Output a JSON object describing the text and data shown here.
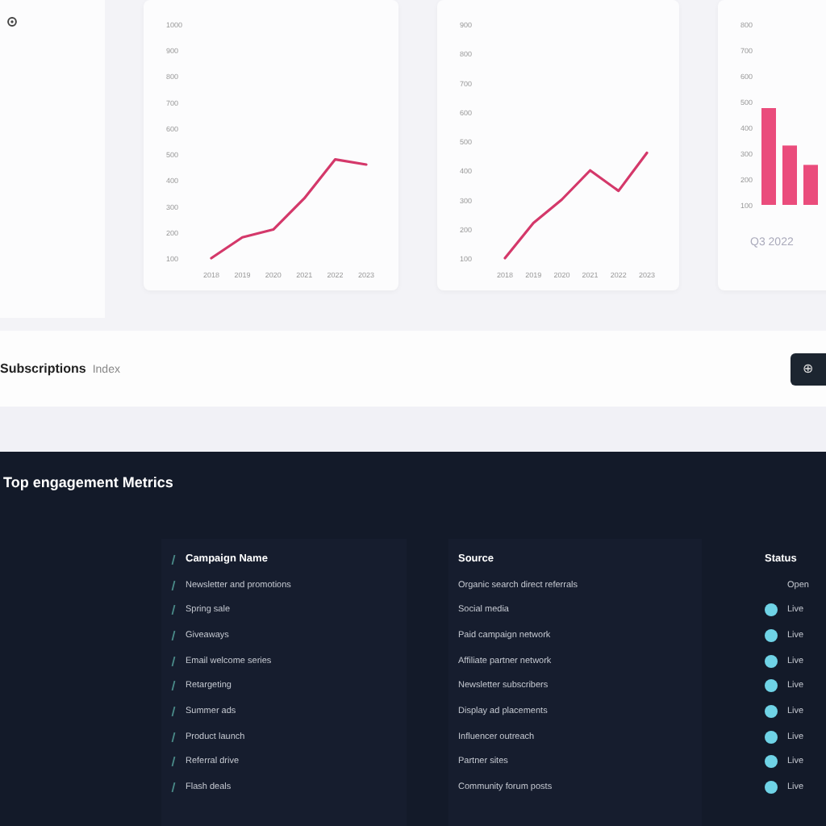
{
  "charts": [
    {
      "chart_data": {
        "type": "line",
        "yticks": [
          100,
          200,
          300,
          400,
          500,
          600,
          700,
          800,
          900,
          1000
        ],
        "ylim": [
          100,
          1000
        ],
        "categories": [
          "2018",
          "2019",
          "2020",
          "2021",
          "2022",
          "2023"
        ],
        "series": [
          {
            "color": "#d4386a",
            "values": [
              100,
              180,
              210,
              330,
              480,
              460
            ]
          }
        ]
      }
    },
    {
      "chart_data": {
        "type": "line",
        "yticks": [
          100,
          200,
          300,
          400,
          500,
          600,
          700,
          800,
          900
        ],
        "ylim": [
          100,
          900
        ],
        "categories": [
          "2018",
          "2019",
          "2020",
          "2021",
          "2022",
          "2023"
        ],
        "series": [
          {
            "color": "#d4386a",
            "values": [
              100,
              220,
              300,
              400,
              330,
              460
            ]
          }
        ]
      }
    },
    {
      "chart_data": {
        "type": "bar",
        "yticks": [
          100,
          200,
          300,
          400,
          500,
          600,
          700,
          800
        ],
        "ylim": [
          100,
          800
        ],
        "categories": [
          null,
          null,
          null
        ],
        "title": "Q3 2022",
        "series": [
          {
            "color": "#ea4c7c",
            "values": [
              475,
              330,
              255
            ]
          }
        ]
      }
    }
  ],
  "toolbar": {
    "title": "Subscriptions",
    "subtitle": "Index",
    "button": "⊕"
  },
  "section": {
    "title": "Top engagement Metrics"
  },
  "panels": [
    {
      "kind": "icon-list",
      "header": "Campaign Name",
      "items": [
        "Newsletter and promotions",
        "Spring sale",
        "Giveaways",
        "Email welcome series",
        "Retargeting",
        "Summer ads",
        "Product launch",
        "Referral drive",
        "Flash deals"
      ]
    },
    {
      "kind": "plain-list",
      "header": "Source",
      "items": [
        "Organic search direct referrals",
        "Social media",
        "Paid campaign network",
        "Affiliate partner network",
        "Newsletter subscribers",
        "Display ad placements",
        "Influencer outreach",
        "Partner sites",
        "Community forum posts"
      ]
    },
    {
      "kind": "dot-list",
      "header": "Status",
      "items": [
        {
          "dot": false,
          "label": "Open"
        },
        {
          "dot": true,
          "label": "Live"
        },
        {
          "dot": true,
          "label": "Live"
        },
        {
          "dot": true,
          "label": "Live"
        },
        {
          "dot": true,
          "label": "Live"
        },
        {
          "dot": true,
          "label": "Live"
        },
        {
          "dot": true,
          "label": "Live"
        },
        {
          "dot": true,
          "label": "Live"
        },
        {
          "dot": true,
          "label": "Live"
        }
      ]
    }
  ]
}
